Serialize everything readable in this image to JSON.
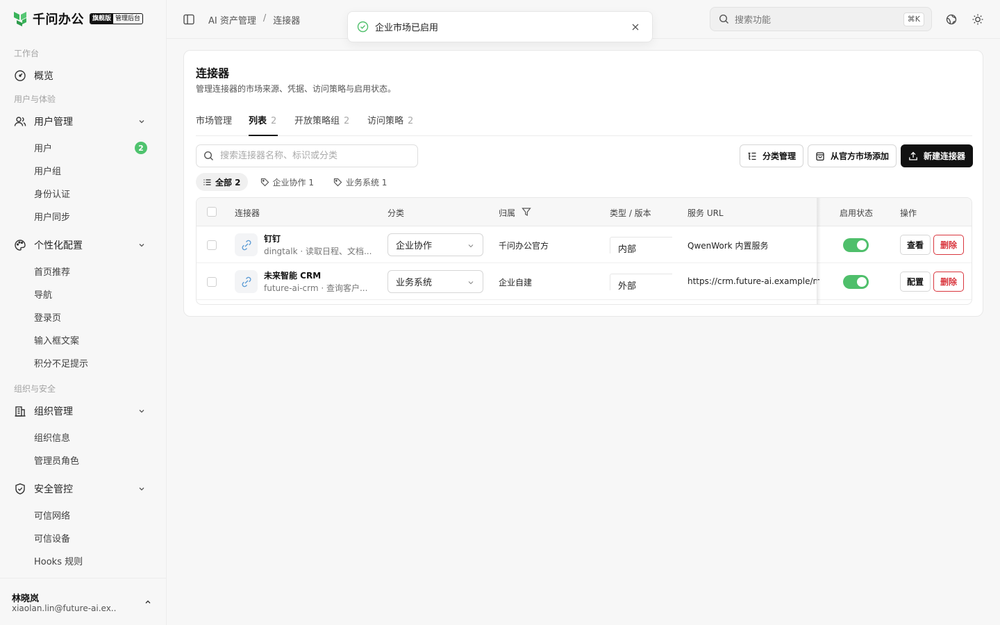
{
  "brand": {
    "name": "千问办公",
    "edition": "旗舰版",
    "admin": "管理后台"
  },
  "sidebar": {
    "sections": [
      "工作台",
      "用户与体验",
      "组织与安全"
    ],
    "overview": "概览",
    "user_mgmt": {
      "label": "用户管理",
      "items": [
        "用户",
        "用户组",
        "身份认证",
        "用户同步"
      ],
      "user_badge": "2"
    },
    "personalize": {
      "label": "个性化配置",
      "items": [
        "首页推荐",
        "导航",
        "登录页",
        "输入框文案",
        "积分不足提示"
      ]
    },
    "org_mgmt": {
      "label": "组织管理",
      "items": [
        "组织信息",
        "管理员角色"
      ]
    },
    "security": {
      "label": "安全管控",
      "items": [
        "可信网络",
        "可信设备",
        "Hooks 规则"
      ]
    },
    "user": {
      "name": "林晓岚",
      "email": "xiaolan.lin@future-ai.ex..."
    }
  },
  "topbar": {
    "breadcrumb": [
      "AI 资产管理",
      "/",
      "连接器"
    ],
    "search_placeholder": "搜索功能",
    "shortcut": "⌘K"
  },
  "toast": {
    "message": "企业市场已启用"
  },
  "page": {
    "title": "连接器",
    "subtitle": "管理连接器的市场来源、凭据、访问策略与启用状态。",
    "tabs": [
      {
        "label": "市场管理",
        "count": ""
      },
      {
        "label": "列表",
        "count": "2"
      },
      {
        "label": "开放策略组",
        "count": "2"
      },
      {
        "label": "访问策略",
        "count": "2"
      }
    ],
    "search_placeholder": "搜索连接器名称、标识或分类",
    "buttons": {
      "category": "分类管理",
      "market_add": "从官方市场添加",
      "create": "新建连接器"
    },
    "filters": [
      {
        "label": "全部 2"
      },
      {
        "label": "企业协作 1"
      },
      {
        "label": "业务系统 1"
      }
    ]
  },
  "table": {
    "columns": [
      "连接器",
      "分类",
      "归属",
      "类型 / 版本",
      "服务 URL",
      "启用状态",
      "操作"
    ],
    "rows": [
      {
        "name": "钉钉",
        "desc": "dingtalk · 读取日程、文档...",
        "category": "企业协作",
        "owner": "千问办公官方",
        "type": "内部",
        "url": "QwenWork 内置服务",
        "enabled": true,
        "action1": "查看",
        "action2": "删除"
      },
      {
        "name": "未来智能 CRM",
        "desc": "future-ai-crm · 查询客户...",
        "category": "业务系统",
        "owner": "企业自建",
        "type": "外部",
        "url": "https://crm.future-ai.example/mcp",
        "enabled": true,
        "action1": "配置",
        "action2": "删除"
      }
    ]
  },
  "colors": {
    "accent_green": "#4fbf6b",
    "danger": "#d9363e",
    "primary": "#111111",
    "logo_green": "#3ab35a"
  }
}
